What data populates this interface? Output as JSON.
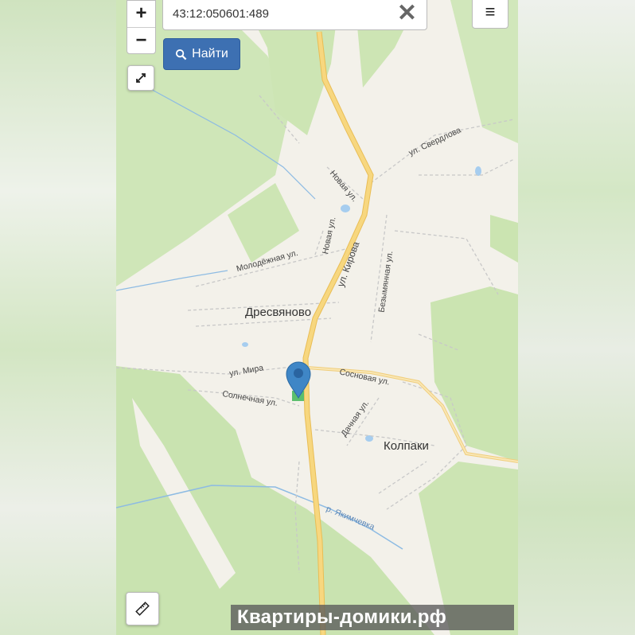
{
  "search": {
    "value": "43:12:050601:489",
    "clear_icon": "close-icon"
  },
  "buttons": {
    "find_label": "Найти",
    "zoom_in": "+",
    "zoom_out": "−",
    "menu": "≡"
  },
  "places": {
    "village1": "Дресвяново",
    "village2": "Колпаки"
  },
  "streets": {
    "kirova": "ул. Кирова",
    "sverdlova": "ул. Свердлова",
    "novaya1": "Новая ул.",
    "novaya2": "Новая ул.",
    "molodezhnaya": "Молодёжная ул.",
    "bezymyannaya": "Безымянная ул.",
    "mira": "ул. Мира",
    "sosnovaya": "Сосновая ул.",
    "solnechnaya": "Солнечная ул.",
    "dachnaya": "Дачная ул.",
    "river": "р. Якимчевка"
  },
  "watermark": "Квартиры-домики.рф",
  "colors": {
    "accent": "#3d70b2",
    "marker": "#3f86c6",
    "road_main": "#f5cf73",
    "forest": "#c9e3b0",
    "water": "#8dbbe3"
  }
}
